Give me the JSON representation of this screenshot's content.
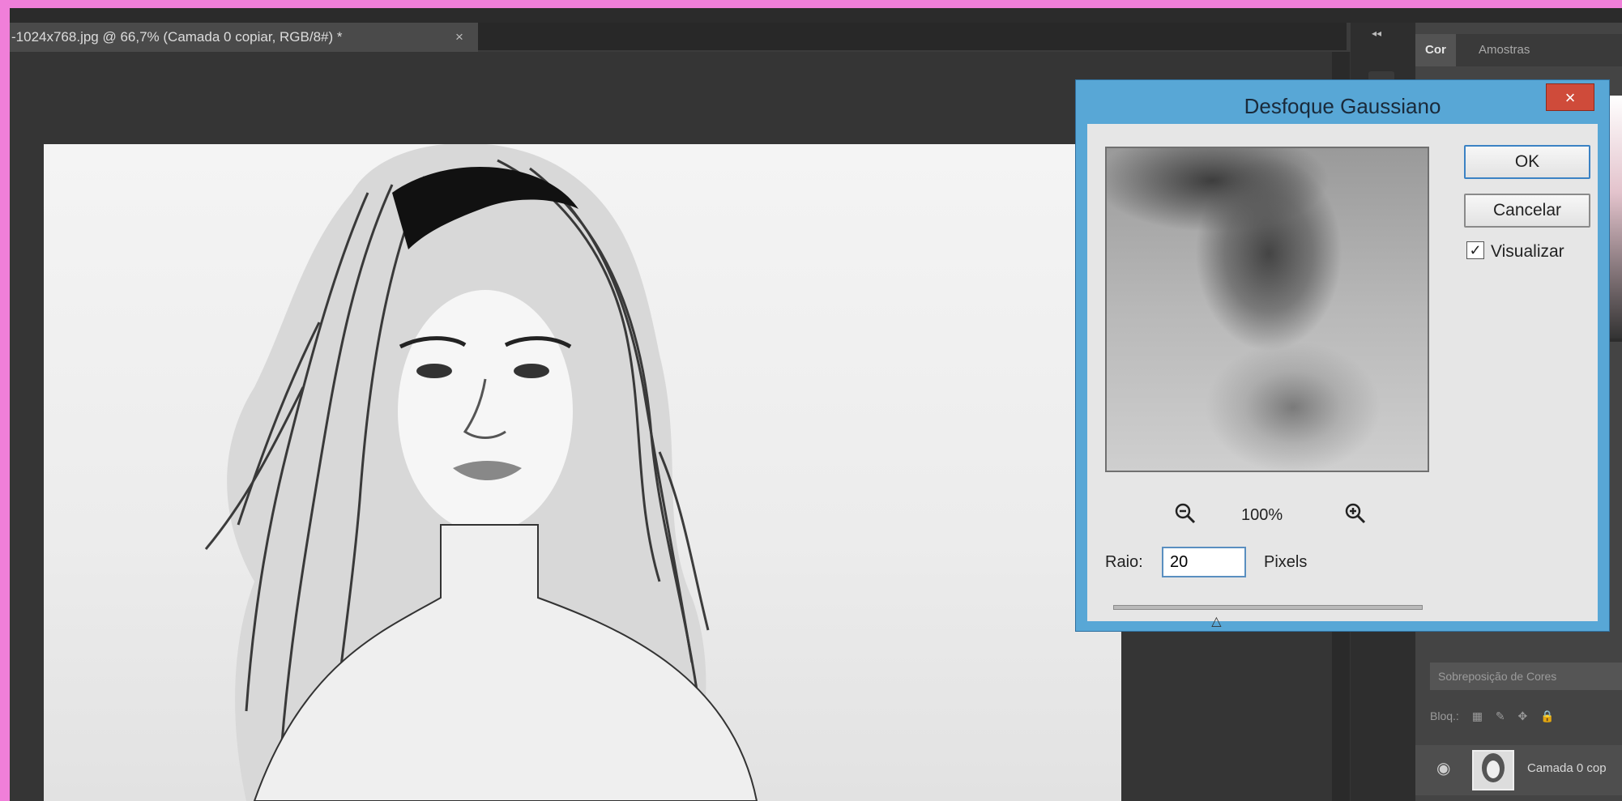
{
  "document": {
    "tab_title": "-1024x768.jpg @ 66,7% (Camada 0 copiar, RGB/8#) *",
    "close_glyph": "×"
  },
  "panel": {
    "tabs": [
      "Cor",
      "Amostras"
    ],
    "blend_mode": "Sobreposição de Cores",
    "lock_label": "Bloq.:",
    "layer_name": "Camada 0 cop"
  },
  "dialog": {
    "title": "Desfoque Gaussiano",
    "close_glyph": "×",
    "ok_label": "OK",
    "cancel_label": "Cancelar",
    "preview_label": "Visualizar",
    "preview_checked": true,
    "zoom_level": "100%",
    "radius_label": "Raio:",
    "radius_value": "20",
    "radius_unit": "Pixels",
    "slider_fraction": 0.34
  },
  "icons": {
    "zoom_out": "zoom-out-icon",
    "zoom_in": "zoom-in-icon",
    "visibility": "eye-icon"
  },
  "colors": {
    "frame": "#f07fd9",
    "dialog_border": "#58a7d6",
    "close_button": "#cf4b3a"
  }
}
